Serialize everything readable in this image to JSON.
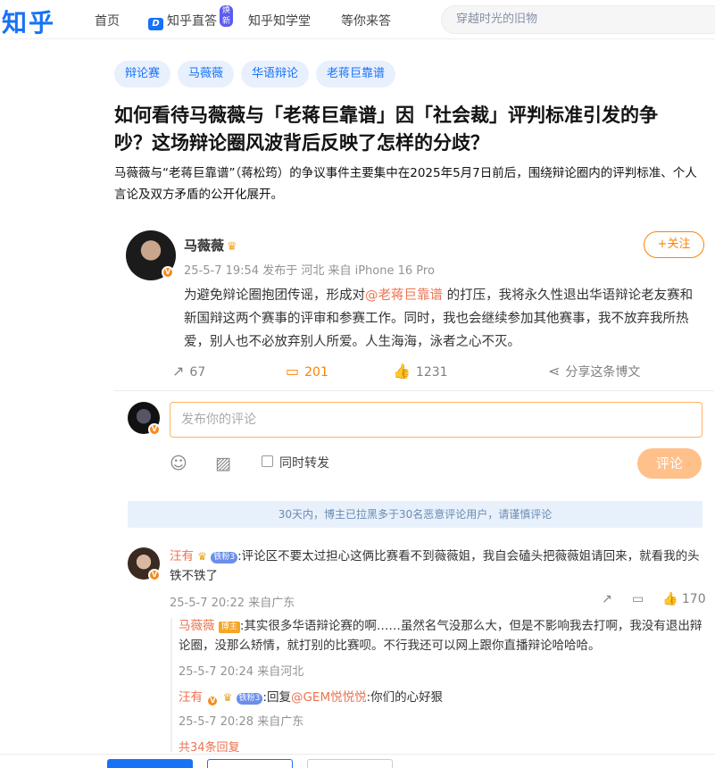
{
  "header": {
    "logo": "知乎",
    "nav": [
      "首页",
      "知乎直答",
      "知乎知学堂",
      "等你来答"
    ],
    "new_badge": "焕新",
    "search_placeholder": "穿越时光的旧物"
  },
  "question": {
    "tags": [
      "辩论赛",
      "马薇薇",
      "华语辩论",
      "老蒋巨靠谱"
    ],
    "title": "如何看待马薇薇与「老蒋巨靠谱」因「社会裁」评判标准引发的争吵？这场辩论圈风波背后反映了怎样的分歧？",
    "description": "马薇薇与“老蒋巨靠谱”（蒋松筠）的争议事件主要集中在2025年5月7日前后，围绕辩论圈内的评判标准、个人言论及双方矛盾的公开化展开。"
  },
  "weibo": {
    "author": "马薇薇",
    "meta": "25-5-7 19:54  发布于 河北  来自 iPhone 16 Pro",
    "follow_label": "+关注",
    "text_before": "为避免辩论圈抱团传谣，形成对",
    "mention": "@老蒋巨靠谱",
    "text_after": " 的打压，我将永久性退出华语辩论老友赛和新国辩这两个赛事的评审和参赛工作。同时，我也会继续参加其他赛事，我不放弃我所热爱，别人也不必放弃别人所爱。人生海海，泳者之心不灭。",
    "reposts": "67",
    "comments": "201",
    "likes": "1231",
    "share_label": "分享这条博文",
    "comment_placeholder": "发布你的评论",
    "forward_label": "同时转发",
    "submit_label": "评论",
    "notice": "30天内，博主已拉黑多于30名恶意评论用户，请谨慎评论"
  },
  "comments": [
    {
      "user": "汪有",
      "badge": "铁粉3",
      "text": ":评论区不要太过担心这俩比赛看不到薇薇姐，我自会磕头把薇薇姐请回来，就看我的头铁不铁了",
      "meta": "25-5-7 20:22 来自广东",
      "likes": "170",
      "replies": [
        {
          "user": "马薇薇",
          "badge": "博主",
          "text": ":其实很多华语辩论赛的啊……虽然名气没那么大，但是不影响我去打啊，我没有退出辩论圈，没那么矫情，就打别的比赛呗。不行我还可以网上跟你直播辩论哈哈哈。",
          "meta": "25-5-7 20:24 来自河北"
        },
        {
          "user": "汪有",
          "badge": "铁粉3",
          "text_prefix": ":回复",
          "mention": "@GEM悦悦悦",
          "text_suffix": ":你们的心好狠",
          "meta": "25-5-7 20:28 来自广东"
        }
      ],
      "more_replies": "共34条回复"
    }
  ],
  "colors": {
    "brand": "#1772f6",
    "weibo_orange": "#ff8200",
    "mention": "#eb7350"
  }
}
